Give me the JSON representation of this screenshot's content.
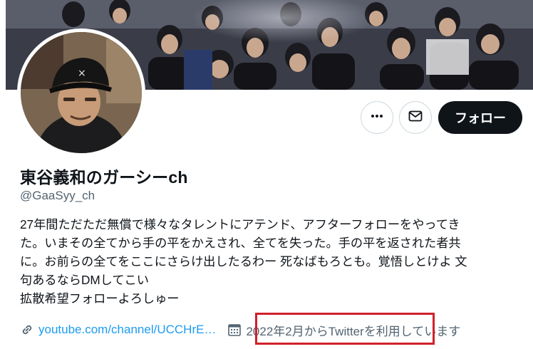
{
  "profile": {
    "display_name": "東谷義和のガーシーch",
    "handle": "@GaaSyy_ch",
    "bio_lines": [
      "27年間ただただ無償で様々なタレントにアテンド、アフターフォローをやってき",
      "た。いまその全てから手の平をかえされ、全てを失った。手の平を返された者共",
      "に。お前らの全てをここにさらけ出したるわー 死なばもろとも。覚悟しとけよ 文",
      "句あるならDMしてこい",
      "拡散希望フォローよろしゅー"
    ],
    "website": "youtube.com/channel/UCCHrE…",
    "joined": "2022年2月からTwitterを利用しています"
  },
  "actions": {
    "more_icon": "more-horizontal-icon",
    "message_icon": "envelope-icon",
    "follow_label": "フォロー"
  },
  "icons": {
    "website": "link-icon",
    "joined": "calendar-icon"
  },
  "colors": {
    "link": "#1d9bf0",
    "secondary_text": "#536471",
    "follow_button_bg": "#0f1419",
    "highlight_border": "#d1202a"
  }
}
